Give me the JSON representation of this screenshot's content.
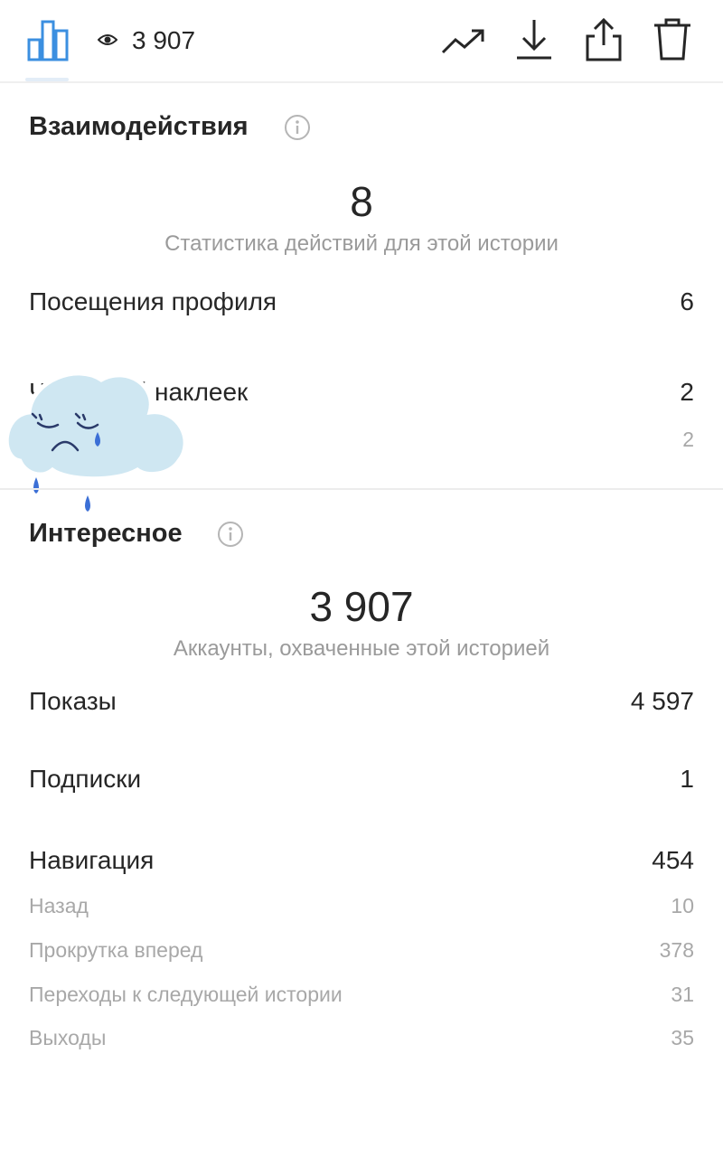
{
  "header": {
    "views_count": "3 907",
    "icons": [
      "bar-chart-icon",
      "eye-icon",
      "trend-icon",
      "download-icon",
      "share-icon",
      "trash-icon"
    ]
  },
  "interactions": {
    "title": "Взаимодействия",
    "total": "8",
    "total_caption": "Статистика действий для этой истории",
    "rows": [
      {
        "label": "Посещения профиля",
        "value": "6"
      },
      {
        "label": "Ч касаний наклеек",
        "value": "2"
      }
    ],
    "sub_rows": [
      {
        "label": "",
        "value": "2"
      }
    ]
  },
  "discovery": {
    "title": "Интересное",
    "total": "3 907",
    "total_caption": "Аккаунты, охваченные этой историей",
    "rows": [
      {
        "label": "Показы",
        "value": "4 597"
      },
      {
        "label": "Подписки",
        "value": "1"
      },
      {
        "label": "Навигация",
        "value": "454"
      }
    ],
    "navigation_details": [
      {
        "label": "Назад",
        "value": "10"
      },
      {
        "label": "Прокрутка вперед",
        "value": "378"
      },
      {
        "label": "Переходы к следующей истории",
        "value": "31"
      },
      {
        "label": "Выходы",
        "value": "35"
      }
    ]
  },
  "colors": {
    "accent": "#3b8fe0",
    "text": "#262626",
    "muted": "#9a9a9a",
    "sticker_cloud": "#cfe7f2"
  }
}
